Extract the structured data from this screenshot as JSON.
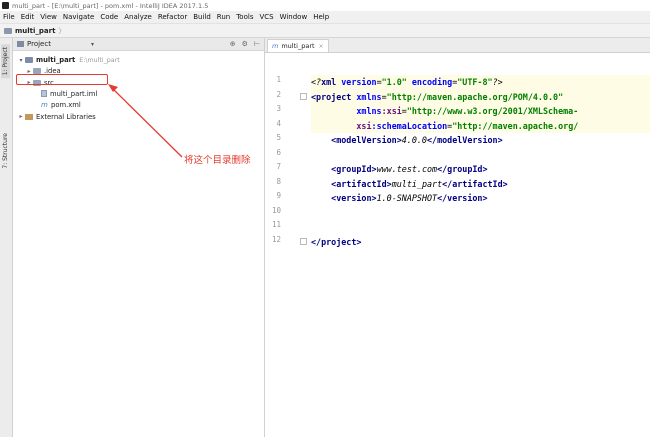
{
  "window": {
    "title": "multi_part - [E:\\multi_part] - pom.xml - IntelliJ IDEA 2017.1.5"
  },
  "menu": [
    "File",
    "Edit",
    "View",
    "Navigate",
    "Code",
    "Analyze",
    "Refactor",
    "Build",
    "Run",
    "Tools",
    "VCS",
    "Window",
    "Help"
  ],
  "breadcrumb": {
    "module": "multi_part",
    "sep": "〉"
  },
  "sidestrip": {
    "project_tab": "1: Project",
    "structure_tab": "7: Structure"
  },
  "project_panel": {
    "title": "Project",
    "caret": "▾",
    "tools": [
      "⊕",
      "⚙",
      "⊢"
    ],
    "tree": [
      {
        "name": "multi_part",
        "path": "E:\\multi_part",
        "arrow": "▾",
        "kind": "root"
      },
      {
        "name": ".idea",
        "arrow": "▸",
        "kind": "folder"
      },
      {
        "name": "src",
        "arrow": "▸",
        "kind": "folder"
      },
      {
        "name": "multi_part.iml",
        "arrow": "",
        "kind": "iml"
      },
      {
        "name": "pom.xml",
        "arrow": "",
        "kind": "pom"
      },
      {
        "name": "External Libraries",
        "arrow": "▸",
        "kind": "lib"
      }
    ]
  },
  "annotation": {
    "text": "将这个目录删除",
    "color": "#e53a2f"
  },
  "editor": {
    "tab_icon": "m",
    "tab_label": "multi_part",
    "tab_close": "×",
    "line_numbers": [
      "1",
      "2",
      "3",
      "4",
      "5",
      "6",
      "7",
      "8",
      "9",
      "10",
      "11",
      "12"
    ],
    "lines": [
      [
        [
          "pi",
          "<?"
        ],
        [
          "tag",
          "xml "
        ],
        [
          "attr",
          "version"
        ],
        [
          "pi",
          "="
        ],
        [
          "val",
          "\"1.0\" "
        ],
        [
          "attr",
          "encoding"
        ],
        [
          "pi",
          "="
        ],
        [
          "val",
          "\"UTF-8\""
        ],
        [
          "pi",
          "?>"
        ]
      ],
      [
        [
          "tag",
          "<project "
        ],
        [
          "attr",
          "xmlns"
        ],
        [
          "pi",
          "="
        ],
        [
          "val",
          "\"http://maven.apache.org/POM/4.0.0\""
        ]
      ],
      [
        [
          "pi",
          "         "
        ],
        [
          "attr",
          "xmlns"
        ],
        [
          "ns",
          ":xsi"
        ],
        [
          "pi",
          "="
        ],
        [
          "val",
          "\"http://www.w3.org/2001/XMLSchema-"
        ]
      ],
      [
        [
          "pi",
          "         "
        ],
        [
          "ns",
          "xsi"
        ],
        [
          "attr",
          ":schemaLocation"
        ],
        [
          "pi",
          "="
        ],
        [
          "val",
          "\"http://maven.apache.org/"
        ]
      ],
      [
        [
          "pi",
          "    "
        ],
        [
          "tag",
          "<modelVersion>"
        ],
        [
          "pi",
          "4.0.0"
        ],
        [
          "tag",
          "</modelVersion>"
        ]
      ],
      [],
      [
        [
          "pi",
          "    "
        ],
        [
          "tag",
          "<groupId>"
        ],
        [
          "pi",
          "www.test.com"
        ],
        [
          "tag",
          "</groupId>"
        ]
      ],
      [
        [
          "pi",
          "    "
        ],
        [
          "tag",
          "<artifactId>"
        ],
        [
          "pi",
          "multi_part"
        ],
        [
          "tag",
          "</artifactId>"
        ]
      ],
      [
        [
          "pi",
          "    "
        ],
        [
          "tag",
          "<version>"
        ],
        [
          "pi",
          "1.0-SNAPSHOT"
        ],
        [
          "tag",
          "</version>"
        ]
      ],
      [],
      [],
      [
        [
          "tag",
          "</project>"
        ]
      ]
    ]
  }
}
